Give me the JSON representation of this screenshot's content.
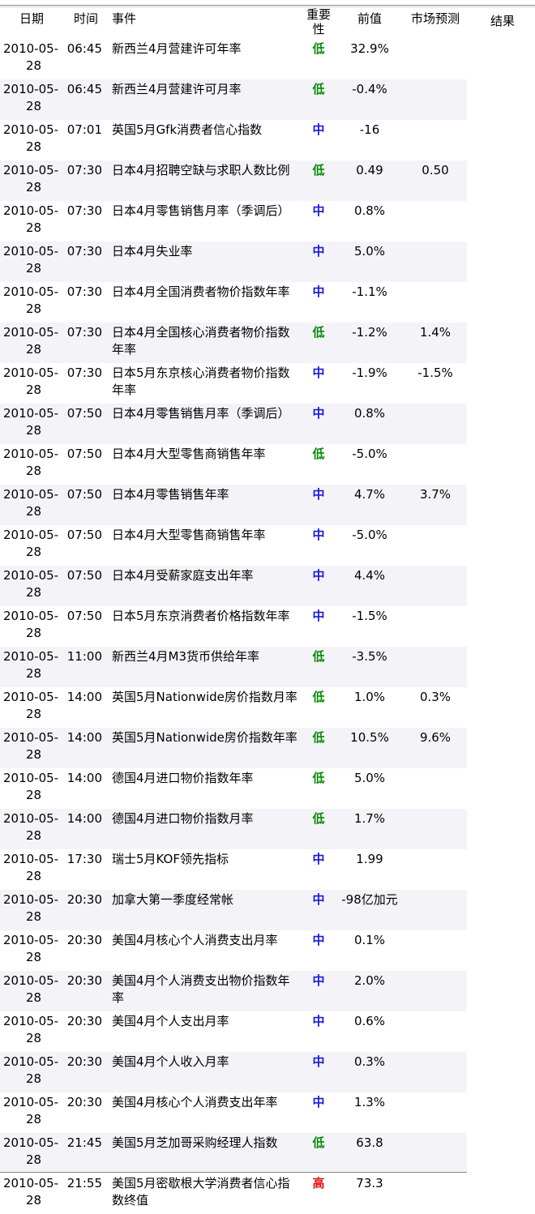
{
  "headers": {
    "date": "日期",
    "time": "时间",
    "event": "事件",
    "importance": "重要性",
    "previous": "前值",
    "forecast": "市场预测",
    "result": "结果"
  },
  "rows": [
    {
      "date1": "2010-05-",
      "date2": "28",
      "time": "06:45",
      "event": "新西兰4月营建许可年率",
      "imp": "低",
      "level": "low",
      "prev": "32.9%",
      "fc": ""
    },
    {
      "date1": "2010-05-",
      "date2": "28",
      "time": "06:45",
      "event": "新西兰4月营建许可月率",
      "imp": "低",
      "level": "low",
      "prev": "-0.4%",
      "fc": ""
    },
    {
      "date1": "2010-05-",
      "date2": "28",
      "time": "07:01",
      "event": "英国5月Gfk消费者信心指数",
      "imp": "中",
      "level": "mid",
      "prev": "-16",
      "fc": ""
    },
    {
      "date1": "2010-05-",
      "date2": "28",
      "time": "07:30",
      "event": "日本4月招聘空缺与求职人数比例",
      "imp": "低",
      "level": "low",
      "prev": "0.49",
      "fc": "0.50"
    },
    {
      "date1": "2010-05-",
      "date2": "28",
      "time": "07:30",
      "event": "日本4月零售销售月率（季调后）",
      "imp": "中",
      "level": "mid",
      "prev": "0.8%",
      "fc": ""
    },
    {
      "date1": "2010-05-",
      "date2": "28",
      "time": "07:30",
      "event": "日本4月失业率",
      "imp": "中",
      "level": "mid",
      "prev": "5.0%",
      "fc": ""
    },
    {
      "date1": "2010-05-",
      "date2": "28",
      "time": "07:30",
      "event": "日本4月全国消费者物价指数年率",
      "imp": "中",
      "level": "mid",
      "prev": "-1.1%",
      "fc": ""
    },
    {
      "date1": "2010-05-",
      "date2": "28",
      "time": "07:30",
      "event": "日本4月全国核心消费者物价指数年率",
      "imp": "低",
      "level": "low",
      "prev": "-1.2%",
      "fc": "1.4%"
    },
    {
      "date1": "2010-05-",
      "date2": "28",
      "time": "07:30",
      "event": "日本5月东京核心消费者物价指数年率",
      "imp": "中",
      "level": "mid",
      "prev": "-1.9%",
      "fc": "-1.5%"
    },
    {
      "date1": "2010-05-",
      "date2": "28",
      "time": "07:50",
      "event": "日本4月零售销售月率（季调后）",
      "imp": "中",
      "level": "mid",
      "prev": "0.8%",
      "fc": ""
    },
    {
      "date1": "2010-05-",
      "date2": "28",
      "time": "07:50",
      "event": "日本4月大型零售商销售年率",
      "imp": "低",
      "level": "low",
      "prev": "-5.0%",
      "fc": ""
    },
    {
      "date1": "2010-05-",
      "date2": "28",
      "time": "07:50",
      "event": "日本4月零售销售年率",
      "imp": "中",
      "level": "mid",
      "prev": "4.7%",
      "fc": "3.7%"
    },
    {
      "date1": "2010-05-",
      "date2": "28",
      "time": "07:50",
      "event": "日本4月大型零售商销售年率",
      "imp": "中",
      "level": "mid",
      "prev": "-5.0%",
      "fc": ""
    },
    {
      "date1": "2010-05-",
      "date2": "28",
      "time": "07:50",
      "event": "日本4月受薪家庭支出年率",
      "imp": "中",
      "level": "mid",
      "prev": "4.4%",
      "fc": ""
    },
    {
      "date1": "2010-05-",
      "date2": "28",
      "time": "07:50",
      "event": "日本5月东京消费者价格指数年率",
      "imp": "中",
      "level": "mid",
      "prev": "-1.5%",
      "fc": ""
    },
    {
      "date1": "2010-05-",
      "date2": "28",
      "time": "11:00",
      "event": "新西兰4月M3货币供给年率",
      "imp": "低",
      "level": "low",
      "prev": "-3.5%",
      "fc": ""
    },
    {
      "date1": "2010-05-",
      "date2": "28",
      "time": "14:00",
      "event": "英国5月Nationwide房价指数月率",
      "imp": "低",
      "level": "low",
      "prev": "1.0%",
      "fc": "0.3%"
    },
    {
      "date1": "2010-05-",
      "date2": "28",
      "time": "14:00",
      "event": "英国5月Nationwide房价指数年率",
      "imp": "低",
      "level": "low",
      "prev": "10.5%",
      "fc": "9.6%"
    },
    {
      "date1": "2010-05-",
      "date2": "28",
      "time": "14:00",
      "event": "德国4月进口物价指数年率",
      "imp": "低",
      "level": "low",
      "prev": "5.0%",
      "fc": ""
    },
    {
      "date1": "2010-05-",
      "date2": "28",
      "time": "14:00",
      "event": "德国4月进口物价指数月率",
      "imp": "低",
      "level": "low",
      "prev": "1.7%",
      "fc": ""
    },
    {
      "date1": "2010-05-",
      "date2": "28",
      "time": "17:30",
      "event": "瑞士5月KOF领先指标",
      "imp": "中",
      "level": "mid",
      "prev": "1.99",
      "fc": ""
    },
    {
      "date1": "2010-05-",
      "date2": "28",
      "time": "20:30",
      "event": "加拿大第一季度经常帐",
      "imp": "中",
      "level": "mid",
      "prev": "-98亿加元",
      "fc": ""
    },
    {
      "date1": "2010-05-",
      "date2": "28",
      "time": "20:30",
      "event": "美国4月核心个人消费支出月率",
      "imp": "中",
      "level": "mid",
      "prev": "0.1%",
      "fc": ""
    },
    {
      "date1": "2010-05-",
      "date2": "28",
      "time": "20:30",
      "event": "美国4月个人消费支出物价指数年率",
      "imp": "中",
      "level": "mid",
      "prev": "2.0%",
      "fc": ""
    },
    {
      "date1": "2010-05-",
      "date2": "28",
      "time": "20:30",
      "event": "美国4月个人支出月率",
      "imp": "中",
      "level": "mid",
      "prev": "0.6%",
      "fc": ""
    },
    {
      "date1": "2010-05-",
      "date2": "28",
      "time": "20:30",
      "event": "美国4月个人收入月率",
      "imp": "中",
      "level": "mid",
      "prev": "0.3%",
      "fc": ""
    },
    {
      "date1": "2010-05-",
      "date2": "28",
      "time": "20:30",
      "event": "美国4月核心个人消费支出年率",
      "imp": "中",
      "level": "mid",
      "prev": "1.3%",
      "fc": ""
    },
    {
      "date1": "2010-05-",
      "date2": "28",
      "time": "21:45",
      "event": "美国5月芝加哥采购经理人指数",
      "imp": "低",
      "level": "low",
      "prev": "63.8",
      "fc": ""
    },
    {
      "date1": "2010-05-",
      "date2": "28",
      "time": "21:55",
      "event": "美国5月密歇根大学消费者信心指数终值",
      "imp": "高",
      "level": "high",
      "prev": "73.3",
      "fc": ""
    }
  ],
  "colors": {
    "low": "#0a8a0a",
    "mid": "#1a1ad6",
    "high": "#e01010",
    "stripe": "#f4f3f7"
  }
}
